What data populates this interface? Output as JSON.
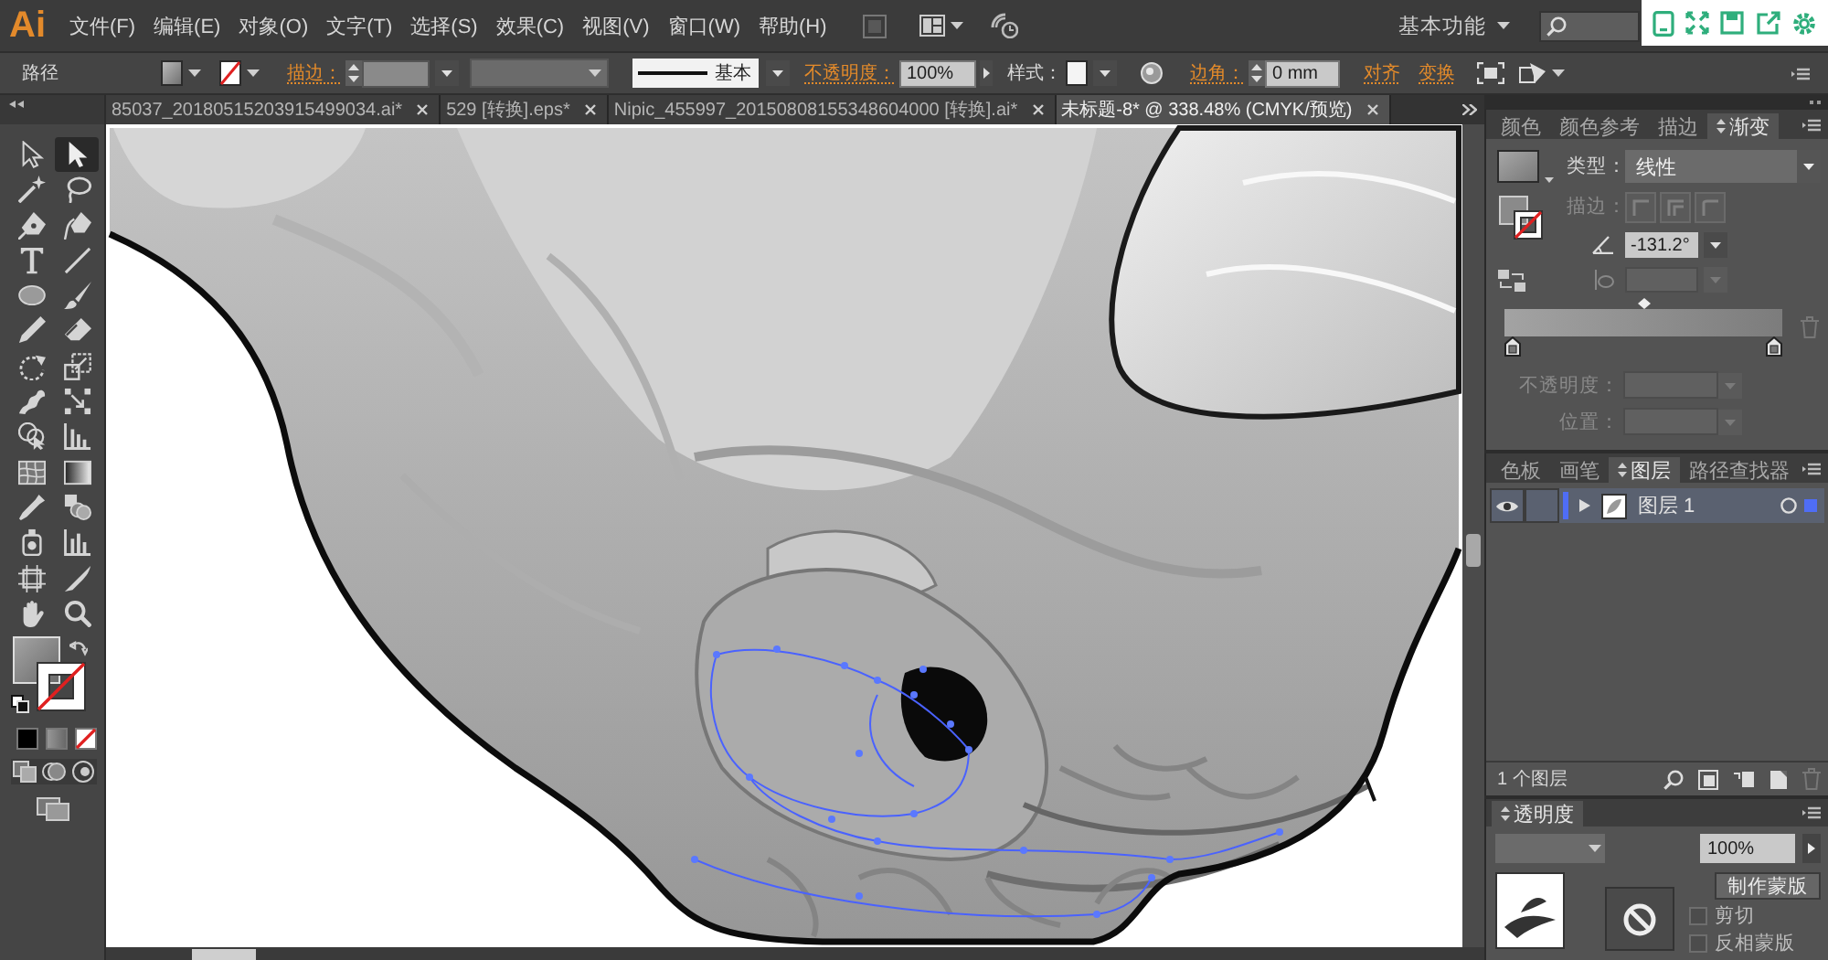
{
  "menu_bar": {
    "logo": "Ai",
    "menus": [
      "文件(F)",
      "编辑(E)",
      "对象(O)",
      "文字(T)",
      "选择(S)",
      "效果(C)",
      "视图(V)",
      "窗口(W)",
      "帮助(H)"
    ],
    "workspace": "基本功能"
  },
  "control_bar": {
    "selection": "路径",
    "stroke_link": "描边：",
    "stroke_style": "基本",
    "opacity_link": "不透明度：",
    "opacity": "100%",
    "style_label": "样式：",
    "corner_link": "边角：",
    "corner": "0 mm",
    "links": [
      "对齐",
      "变换"
    ]
  },
  "document_tabs": [
    {
      "label": "85037_20180515203915499034.ai*",
      "selected": false
    },
    {
      "label": "529 [转换].eps*",
      "selected": false
    },
    {
      "label": "Nipic_455997_20150808155348604000 [转换].ai*",
      "selected": false
    },
    {
      "label": "未标题-8* @ 338.48% (CMYK/预览)",
      "selected": true
    }
  ],
  "tools": [
    {
      "kind": "selection",
      "selected": false
    },
    {
      "kind": "direct-selection",
      "selected": true
    },
    {
      "kind": "magic-wand",
      "selected": false
    },
    {
      "kind": "lasso",
      "selected": false
    },
    {
      "kind": "pen",
      "selected": false
    },
    {
      "kind": "curvature",
      "selected": false
    },
    {
      "kind": "type",
      "selected": false
    },
    {
      "kind": "line",
      "selected": false
    },
    {
      "kind": "ellipse",
      "selected": false
    },
    {
      "kind": "paintbrush",
      "selected": false
    },
    {
      "kind": "pencil",
      "selected": false
    },
    {
      "kind": "eraser",
      "selected": false
    },
    {
      "kind": "rotate",
      "selected": false
    },
    {
      "kind": "scale",
      "selected": false
    },
    {
      "kind": "width",
      "selected": false
    },
    {
      "kind": "free-transform",
      "selected": false
    },
    {
      "kind": "shape-builder",
      "selected": false
    },
    {
      "kind": "perspective-grid",
      "selected": false
    },
    {
      "kind": "mesh",
      "selected": false
    },
    {
      "kind": "gradient",
      "selected": false
    },
    {
      "kind": "eyedropper",
      "selected": false
    },
    {
      "kind": "blend",
      "selected": false
    },
    {
      "kind": "symbol-sprayer",
      "selected": false
    },
    {
      "kind": "column-graph",
      "selected": false
    },
    {
      "kind": "artboard",
      "selected": false
    },
    {
      "kind": "slice",
      "selected": false
    },
    {
      "kind": "hand",
      "selected": false
    },
    {
      "kind": "zoom",
      "selected": false
    }
  ],
  "gradient_panel": {
    "tabs": [
      {
        "label": "颜色",
        "selected": false
      },
      {
        "label": "颜色参考",
        "selected": false
      },
      {
        "label": "描边",
        "selected": false
      },
      {
        "label": "渐变",
        "selected": true
      }
    ],
    "type_label": "类型：",
    "type": "线性",
    "stroke_label": "描边：",
    "angle": "-131.2°",
    "midpoint": {
      "level": 0.5
    },
    "stops": [
      {
        "level": 0
      },
      {
        "level": 1
      }
    ],
    "opacity_label": "不透明度：",
    "location_label": "位置："
  },
  "layers_panel": {
    "tabs": [
      {
        "label": "色板",
        "selected": false
      },
      {
        "label": "画笔",
        "selected": false
      },
      {
        "label": "图层",
        "selected": true
      },
      {
        "label": "路径查找器",
        "selected": false
      }
    ],
    "layers": [
      {
        "name": "图层 1",
        "visible": true,
        "expanded": false,
        "selected": true,
        "color": "#4f6df5"
      }
    ],
    "count": "1 个图层"
  },
  "transparency_panel": {
    "tabs": [
      {
        "label": "透明度",
        "selected": true
      }
    ],
    "opacity": "100%",
    "mask_button": "制作蒙版",
    "options": [
      {
        "label": "剪切",
        "checked": false
      },
      {
        "label": "反相蒙版",
        "checked": false
      }
    ]
  }
}
